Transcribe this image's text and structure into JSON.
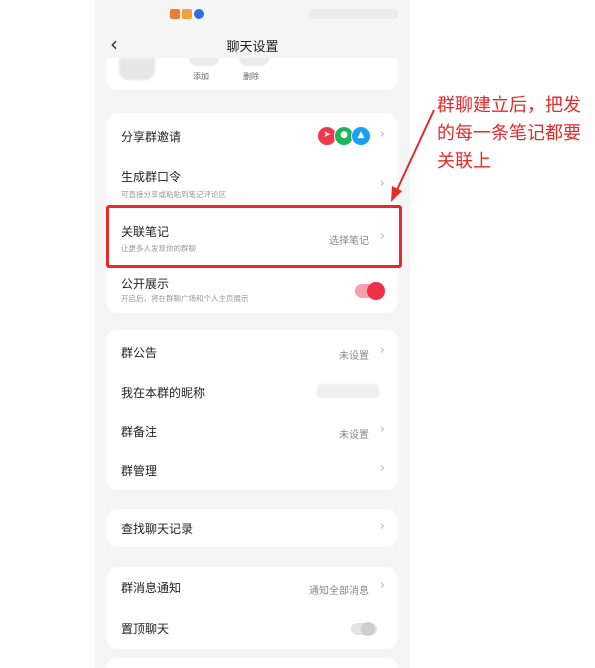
{
  "nav": {
    "title": "聊天设置",
    "back_icon": "chevron-left-icon"
  },
  "members": {
    "add_label": "添加",
    "remove_label": "删除"
  },
  "group_section": {
    "share_invite": {
      "title": "分享群邀请",
      "icons": [
        "send-icon",
        "wechat-icon",
        "qq-icon"
      ],
      "icon_colors": [
        "#f0384d",
        "#1fb35a",
        "#1aa0f0"
      ]
    },
    "group_code": {
      "title": "生成群口令",
      "subtitle": "可直接分享或粘贴到笔记评论区"
    },
    "linked_notes": {
      "title": "关联笔记",
      "subtitle": "让更多人发现你的群聊",
      "value": "选择笔记"
    },
    "public_display": {
      "title": "公开展示",
      "subtitle": "开启后，将在群聊广场和个人主页展示",
      "enabled": true
    }
  },
  "info_section": {
    "announcement": {
      "title": "群公告",
      "value": "未设置"
    },
    "nickname": {
      "title": "我在本群的昵称"
    },
    "remark": {
      "title": "群备注",
      "value": "未设置"
    },
    "manage": {
      "title": "群管理"
    }
  },
  "search_section": {
    "title": "查找聊天记录"
  },
  "notify_section": {
    "notification": {
      "title": "群消息通知",
      "value": "通知全部消息"
    },
    "pin": {
      "title": "置顶聊天",
      "enabled": false
    }
  },
  "annotation": {
    "text": "群聊建立后，把发的每一条笔记都要关联上",
    "color": "#e52a2a"
  },
  "colors": {
    "accent": "#ef3048",
    "background": "#f5f5f5"
  }
}
